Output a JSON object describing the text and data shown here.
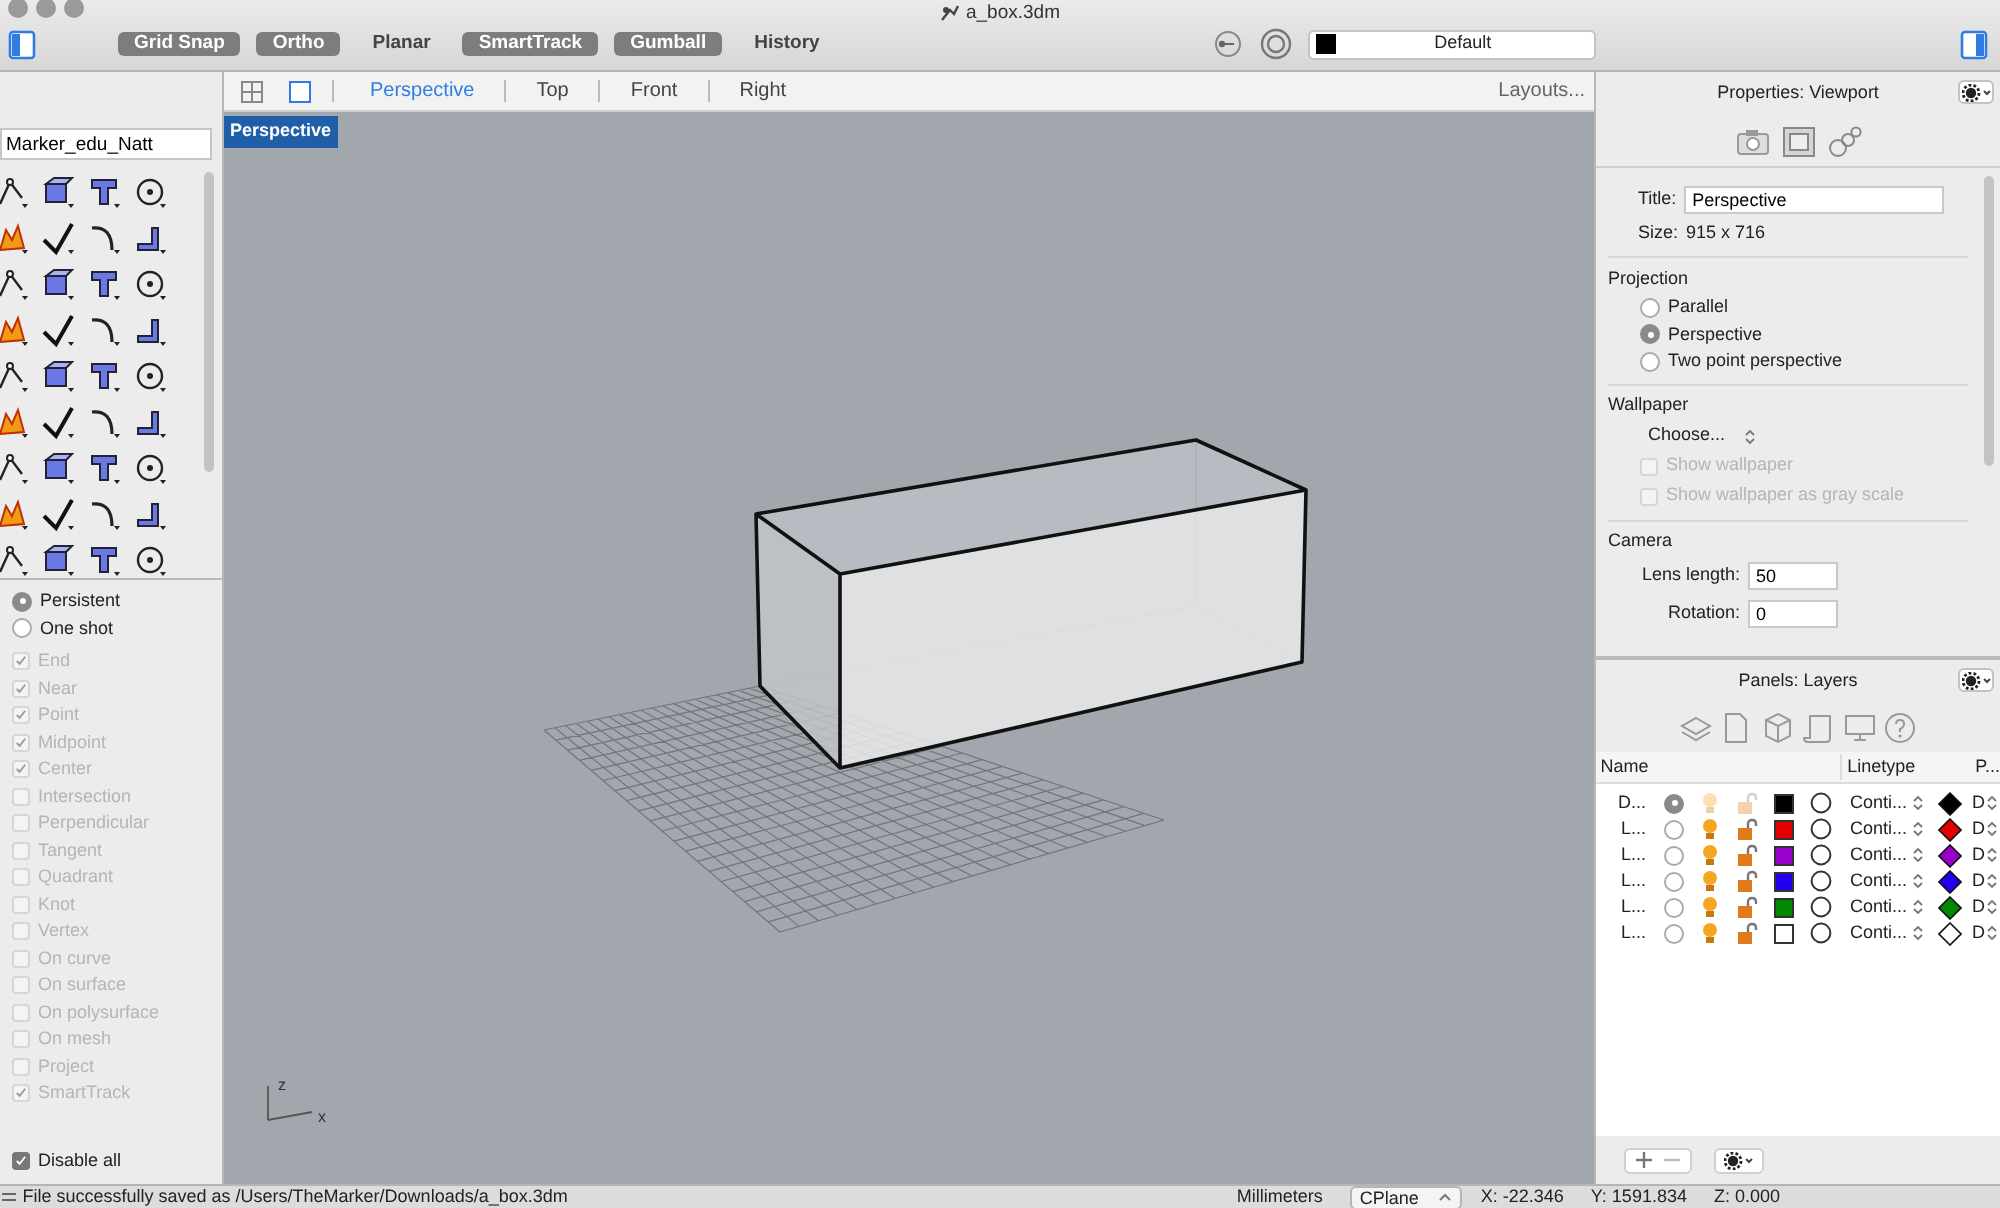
{
  "window": {
    "title": "a_box.3dm"
  },
  "toolbar": {
    "buttons": [
      {
        "label": "Grid Snap",
        "on": true
      },
      {
        "label": "Ortho",
        "on": true
      },
      {
        "label": "Planar",
        "on": false
      },
      {
        "label": "SmartTrack",
        "on": true
      },
      {
        "label": "Gumball",
        "on": true
      },
      {
        "label": "History",
        "on": false
      }
    ],
    "layer": {
      "name": "Default",
      "color": "#000000"
    }
  },
  "command_panel": {
    "field": {
      "value": "Marker_edu_Natt"
    }
  },
  "osnap": {
    "modes": [
      {
        "label": "Persistent",
        "selected": true
      },
      {
        "label": "One shot",
        "selected": false
      }
    ],
    "items": [
      {
        "label": "End",
        "checked": true
      },
      {
        "label": "Near",
        "checked": true
      },
      {
        "label": "Point",
        "checked": true
      },
      {
        "label": "Midpoint",
        "checked": true
      },
      {
        "label": "Center",
        "checked": true
      },
      {
        "label": "Intersection",
        "checked": false
      },
      {
        "label": "Perpendicular",
        "checked": false
      },
      {
        "label": "Tangent",
        "checked": false
      },
      {
        "label": "Quadrant",
        "checked": false
      },
      {
        "label": "Knot",
        "checked": false
      },
      {
        "label": "Vertex",
        "checked": false
      },
      {
        "label": "On curve",
        "checked": false
      },
      {
        "label": "On surface",
        "checked": false
      },
      {
        "label": "On polysurface",
        "checked": false
      },
      {
        "label": "On mesh",
        "checked": false
      },
      {
        "label": "Project",
        "checked": false
      },
      {
        "label": "SmartTrack",
        "checked": true
      }
    ],
    "disable_all": {
      "label": "Disable all",
      "checked": true
    }
  },
  "viewport_tabs": {
    "tabs": [
      {
        "label": "Perspective",
        "selected": true
      },
      {
        "label": "Top",
        "selected": false
      },
      {
        "label": "Front",
        "selected": false
      },
      {
        "label": "Right",
        "selected": false
      }
    ],
    "layouts": "Layouts..."
  },
  "viewport": {
    "label": "Perspective",
    "axes": [
      "z",
      "x"
    ]
  },
  "properties": {
    "title": "Properties: Viewport",
    "title_field": {
      "label": "Title:",
      "value": "Perspective"
    },
    "size": {
      "label": "Size:",
      "value": "915 x 716"
    },
    "projection": {
      "heading": "Projection",
      "options": [
        {
          "label": "Parallel",
          "selected": false
        },
        {
          "label": "Perspective",
          "selected": true
        },
        {
          "label": "Two point perspective",
          "selected": false
        }
      ]
    },
    "wallpaper": {
      "heading": "Wallpaper",
      "choose": "Choose...",
      "options": [
        {
          "label": "Show wallpaper",
          "checked": false,
          "disabled": true
        },
        {
          "label": "Show wallpaper as gray scale",
          "checked": false,
          "disabled": true
        }
      ]
    },
    "camera": {
      "heading": "Camera",
      "fields": [
        {
          "label": "Lens length:",
          "value": "50"
        },
        {
          "label": "Rotation:",
          "value": "0"
        }
      ]
    }
  },
  "layers": {
    "title": "Panels: Layers",
    "columns": [
      "Name",
      "Linetype",
      "P..."
    ],
    "rows": [
      {
        "name": "D...",
        "current": true,
        "color": "#000000",
        "linetype": "Conti...",
        "print": {
          "color": "#000000",
          "width": "D"
        }
      },
      {
        "name": "L...",
        "current": false,
        "color": "#e00000",
        "linetype": "Conti...",
        "print": {
          "color": "#e00000",
          "width": "D"
        }
      },
      {
        "name": "L...",
        "current": false,
        "color": "#9900cc",
        "linetype": "Conti...",
        "print": {
          "color": "#9900cc",
          "width": "D"
        }
      },
      {
        "name": "L...",
        "current": false,
        "color": "#2200ee",
        "linetype": "Conti...",
        "print": {
          "color": "#2200ee",
          "width": "D"
        }
      },
      {
        "name": "L...",
        "current": false,
        "color": "#008800",
        "linetype": "Conti...",
        "print": {
          "color": "#008800",
          "width": "D"
        }
      },
      {
        "name": "L...",
        "current": false,
        "color": "#ffffff",
        "linetype": "Conti...",
        "print": {
          "color": "#ffffff",
          "width": "D"
        }
      }
    ]
  },
  "status_bar": {
    "message": "File successfully saved as /Users/TheMarker/Downloads/a_box.3dm",
    "units": "Millimeters",
    "cplane": "CPlane",
    "x": "X: -22.346",
    "y": "Y: 1591.834",
    "z": "Z: 0.000"
  }
}
